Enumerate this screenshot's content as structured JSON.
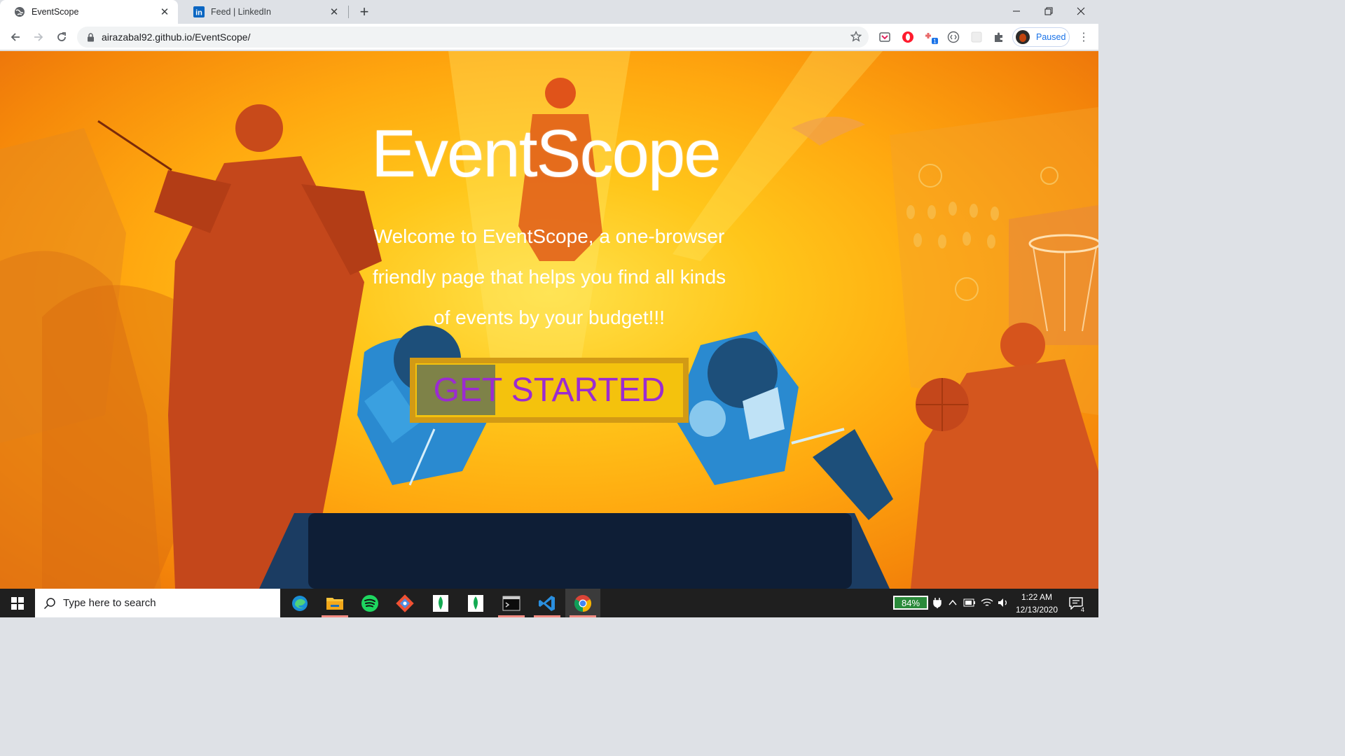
{
  "browser": {
    "tabs": [
      {
        "title": "EventScope",
        "favicon": "globe-icon",
        "active": true
      },
      {
        "title": "Feed | LinkedIn",
        "favicon": "linkedin-icon",
        "active": false
      }
    ],
    "url": "airazabal92.github.io/EventScope/",
    "profile_status": "Paused"
  },
  "page": {
    "title": "EventScope",
    "intro": "Welcome to EventScope, a one-browser friendly page that helps you find all kinds of events by your budget!!!",
    "cta_label": "GET STARTED",
    "colors": {
      "cta_text": "#9b2bd1",
      "cta_background": "#f4c20d",
      "cta_border": "#d29a15",
      "hero_text": "#ffffff"
    }
  },
  "taskbar": {
    "search_placeholder": "Type here to search",
    "apps": [
      "edge-icon",
      "file-explorer-icon",
      "spotify-icon",
      "git-icon",
      "mongodb-icon",
      "mongodb-icon",
      "terminal-icon",
      "vscode-icon",
      "chrome-icon"
    ],
    "battery": "84%",
    "time": "1:22 AM",
    "date": "12/13/2020",
    "notification_count": "4"
  }
}
